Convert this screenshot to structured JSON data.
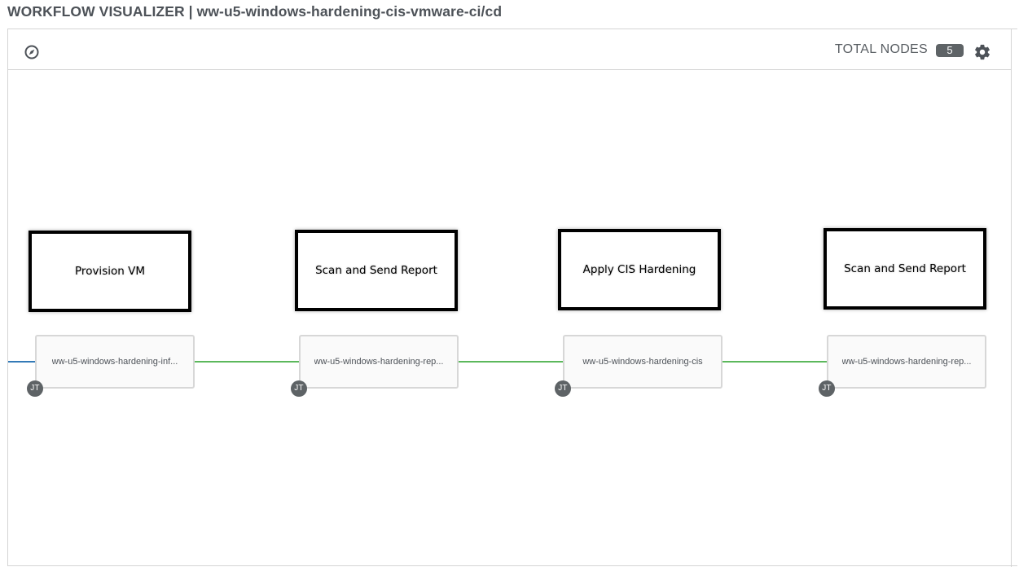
{
  "header": {
    "title": "WORKFLOW VISUALIZER | ww-u5-windows-hardening-cis-vmware-ci/cd"
  },
  "toolbar": {
    "compass_icon": "compass-icon",
    "total_nodes_label": "TOTAL NODES",
    "total_nodes_count": "5",
    "settings_icon": "gear-icon"
  },
  "colors": {
    "link_success": "#5cb85c",
    "link_always": "#337ab7",
    "badge_bg": "#5e6366"
  },
  "annotations": [
    {
      "label": "Provision VM"
    },
    {
      "label": "Scan and Send Report"
    },
    {
      "label": "Apply CIS Hardening"
    },
    {
      "label": "Scan and Send Report"
    }
  ],
  "nodes": [
    {
      "name": "ww-u5-windows-hardening-inf...",
      "type_badge": "JT"
    },
    {
      "name": "ww-u5-windows-hardening-rep...",
      "type_badge": "JT"
    },
    {
      "name": "ww-u5-windows-hardening-cis",
      "type_badge": "JT"
    },
    {
      "name": "ww-u5-windows-hardening-rep...",
      "type_badge": "JT"
    }
  ]
}
